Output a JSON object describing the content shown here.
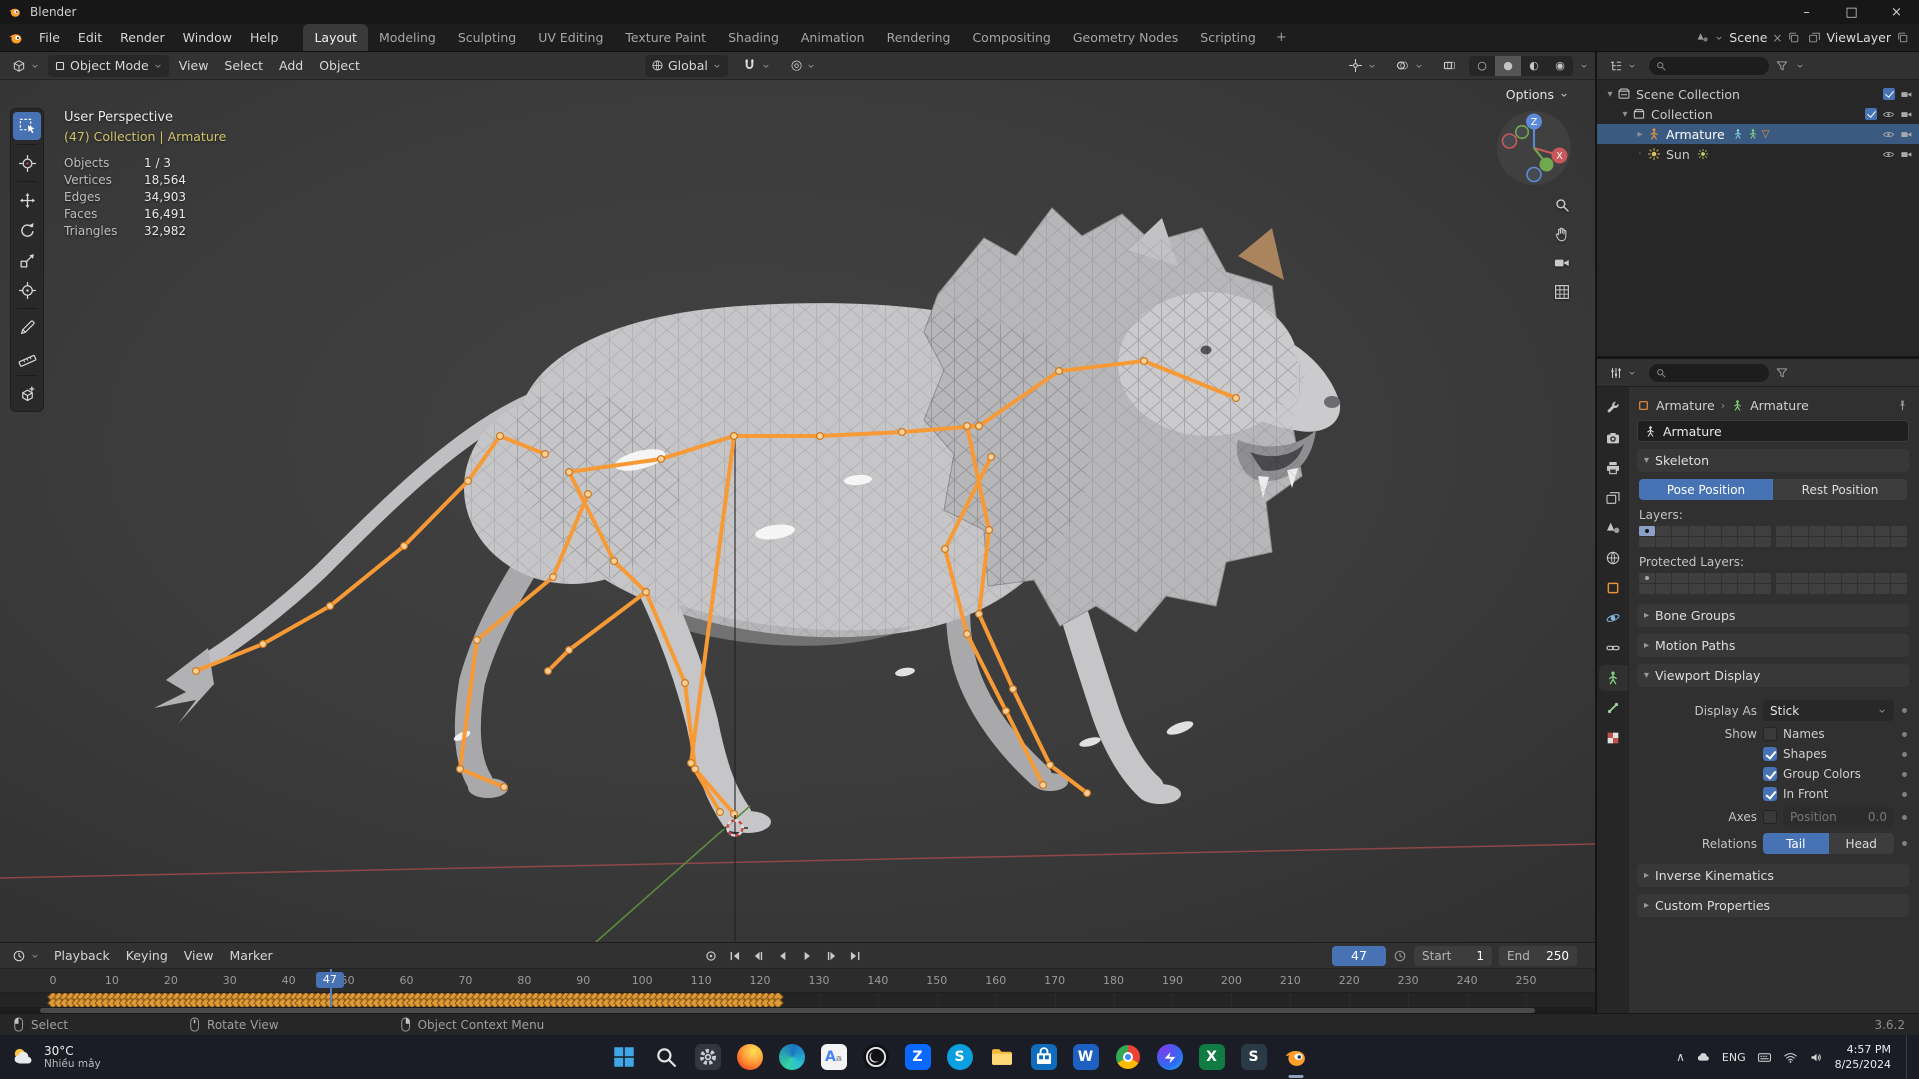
{
  "window": {
    "title": "Blender"
  },
  "colors": {
    "accent": "#4772b3",
    "kf": "#e09a3a",
    "bone": "#f79a36",
    "sel": "#3b5a82",
    "orange": "#e8913c",
    "green": "#83d07f"
  },
  "topbar": {
    "menus": [
      "File",
      "Edit",
      "Render",
      "Window",
      "Help"
    ],
    "workspaces": [
      "Layout",
      "Modeling",
      "Sculpting",
      "UV Editing",
      "Texture Paint",
      "Shading",
      "Animation",
      "Rendering",
      "Compositing",
      "Geometry Nodes",
      "Scripting"
    ],
    "active_workspace": "Layout",
    "add_tab": "+",
    "scene_selector": {
      "label": "Scene"
    },
    "viewlayer_selector": {
      "label": "ViewLayer"
    }
  },
  "viewport_header": {
    "mode": "Object Mode",
    "menus": [
      "View",
      "Select",
      "Add",
      "Object"
    ],
    "orientation": "Global"
  },
  "viewport": {
    "options_label": "Options",
    "view_label": "User Perspective",
    "context_label": "(47) Collection | Armature",
    "stats": [
      {
        "label": "Objects",
        "value": "1 / 3"
      },
      {
        "label": "Vertices",
        "value": "18,564"
      },
      {
        "label": "Edges",
        "value": "34,903"
      },
      {
        "label": "Faces",
        "value": "16,491"
      },
      {
        "label": "Triangles",
        "value": "32,982"
      }
    ],
    "gizmo": {
      "up": "Z",
      "right": "X"
    }
  },
  "tools": [
    {
      "name": "select-box",
      "active": true
    },
    {
      "name": "cursor"
    },
    {
      "name": "move"
    },
    {
      "name": "rotate"
    },
    {
      "name": "scale"
    },
    {
      "name": "transform"
    },
    {
      "name": "annotate"
    },
    {
      "name": "measure"
    },
    {
      "name": "add-cube"
    }
  ],
  "outliner": {
    "rows": [
      {
        "label": "Scene Collection",
        "depth": 0,
        "icon": "scene-collection",
        "caret": "open",
        "right": [
          "checkbox",
          "camera"
        ]
      },
      {
        "label": "Collection",
        "depth": 1,
        "icon": "collection",
        "caret": "open",
        "right": [
          "checkbox",
          "eye",
          "camera"
        ]
      },
      {
        "label": "Armature",
        "depth": 2,
        "icon": "armature",
        "caret": "closed",
        "selected": true,
        "badges": [
          "pose",
          "data",
          "triangle"
        ],
        "right": [
          "eye",
          "camera"
        ]
      },
      {
        "label": "Sun",
        "depth": 2,
        "icon": "sun",
        "caret": "dot",
        "badges": [
          "sun-data"
        ],
        "right": [
          "eye",
          "camera"
        ]
      }
    ]
  },
  "properties": {
    "tabs": [
      {
        "name": "tool"
      },
      {
        "name": "render"
      },
      {
        "name": "output"
      },
      {
        "name": "view-layer"
      },
      {
        "name": "scene"
      },
      {
        "name": "world"
      },
      {
        "name": "object"
      },
      {
        "name": "physics"
      },
      {
        "name": "constraints"
      },
      {
        "name": "object-data",
        "active": true
      },
      {
        "name": "bone"
      },
      {
        "name": "texture"
      }
    ],
    "breadcrumb": {
      "root": "Armature",
      "leaf": "Armature"
    },
    "name_value": "Armature",
    "skeleton": {
      "title": "Skeleton",
      "pose_label": "Pose Position",
      "rest_label": "Rest Position",
      "active": "pose",
      "layers_label": "Layers:",
      "protected_label": "Protected Layers:"
    },
    "panels_collapsed_mid": [
      "Bone Groups",
      "Motion Paths"
    ],
    "viewport_display": {
      "title": "Viewport Display",
      "display_as_label": "Display As",
      "display_as_value": "Stick",
      "show_label": "Show",
      "show_options": [
        {
          "label": "Names",
          "checked": false
        },
        {
          "label": "Shapes",
          "checked": true
        },
        {
          "label": "Group Colors",
          "checked": true
        },
        {
          "label": "In Front",
          "checked": true
        }
      ],
      "axes_label": "Axes",
      "axes_checked": false,
      "position_label": "Position",
      "position_value": "0.0",
      "relations_label": "Relations",
      "tail_label": "Tail",
      "head_label": "Head",
      "relations_active": "tail"
    },
    "panels_collapsed_bottom": [
      "Inverse Kinematics",
      "Custom Properties"
    ]
  },
  "timeline": {
    "menus": [
      "Playback",
      "Keying",
      "View",
      "Marker"
    ],
    "current_frame": 47,
    "frame_start_label": "Start",
    "frame_start": 1,
    "frame_end_label": "End",
    "frame_end": 250,
    "ruler": {
      "min": 0,
      "max": 250,
      "step": 10
    },
    "keyframes": {
      "start": 0,
      "end": 123
    }
  },
  "statusbar": {
    "hints": [
      {
        "mouse": "left",
        "label": "Select"
      },
      {
        "mouse": "middle",
        "label": "Rotate View"
      },
      {
        "mouse": "right",
        "label": "Object Context Menu"
      }
    ],
    "version": "3.6.2"
  },
  "taskbar": {
    "weather_temp": "30°C",
    "weather_desc": "Nhiều mây",
    "apps": [
      "windows-start",
      "search",
      "settings",
      "firefox",
      "edge",
      "google-translate",
      "obs-studio",
      "zalo",
      "skype",
      "file-explorer",
      "microsoft-store",
      "word",
      "chrome",
      "messenger",
      "excel",
      "sharex",
      "blender"
    ],
    "active_app": "blender",
    "tray_lang": "ENG",
    "time": "4:57 PM",
    "date": "8/25/2024"
  }
}
